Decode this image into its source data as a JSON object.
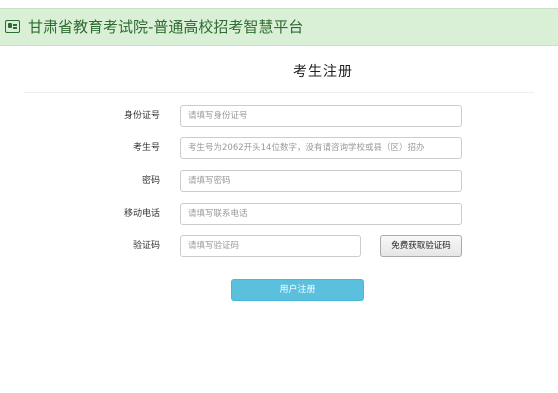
{
  "header": {
    "title": "甘肃省教育考试院-普通高校招考智慧平台"
  },
  "form": {
    "title": "考生注册",
    "fields": [
      {
        "label": "身份证号",
        "placeholder": "请填写身份证号"
      },
      {
        "label": "考生号",
        "placeholder": "考生号为2062开头14位数字，没有请咨询学校或县（区）招办"
      },
      {
        "label": "密码",
        "placeholder": "请填写密码"
      },
      {
        "label": "移动电话",
        "placeholder": "请填写联系电话"
      },
      {
        "label": "验证码",
        "placeholder": "请填写验证码"
      }
    ],
    "sms_button_label": "免费获取验证码",
    "submit_label": "用户注册"
  },
  "colors": {
    "header_bg": "#d9efd6",
    "header_text": "#2f6b32",
    "submit_bg": "#5bc0de"
  }
}
